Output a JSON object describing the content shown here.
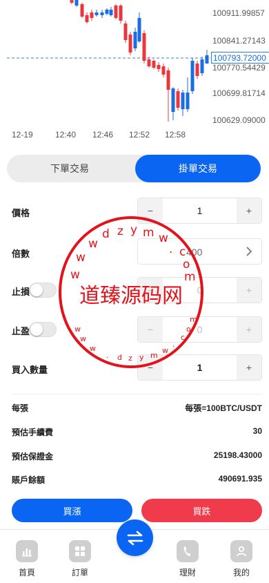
{
  "chart": {
    "price_levels": [
      "100911.99857",
      "100841.27143",
      "100770.54429",
      "100699.81714",
      "100629.09000"
    ],
    "current_price": "100793.72000",
    "time_labels": [
      "12-19",
      "12:40",
      "12:46",
      "12:52",
      "12:58"
    ],
    "colors": {
      "up": "#1a6ee0",
      "down": "#e8383d",
      "grid": "#2f7be6"
    }
  },
  "chart_data": {
    "type": "candlestick",
    "x": [
      "12-19",
      "12:40",
      "12:46",
      "12:52",
      "12:58"
    ],
    "y_ticks": [
      100911.99857,
      100841.27143,
      100770.54429,
      100699.81714,
      100629.09
    ],
    "current_price": 100793.72
  },
  "tabs": {
    "market_order": "下單交易",
    "limit_order": "掛單交易"
  },
  "form": {
    "price_label": "價格",
    "price_value": "1",
    "multiplier_label": "倍數",
    "multiplier_value": "400",
    "stop_loss_label": "止損",
    "stop_loss_value": "0",
    "take_profit_label": "止盈",
    "take_profit_value": "0",
    "quantity_label": "買入數量",
    "quantity_value": "1",
    "minus": "−",
    "plus": "+"
  },
  "info": {
    "per_lot_label": "每張",
    "per_lot_value": "每張=100BTC/USDT",
    "fee_label": "預估手續費",
    "fee_value": "30",
    "margin_label": "預估保證金",
    "margin_value": "25198.43000",
    "balance_label": "賬戶餘額",
    "balance_value": "490691.935"
  },
  "actions": {
    "buy_long": "買漲",
    "buy_short": "買跌"
  },
  "nav": {
    "home": "首頁",
    "orders": "訂單",
    "finance": "理財",
    "mine": "我的"
  },
  "watermark": {
    "site": "dzymw.com",
    "text": "道臻源码网"
  }
}
